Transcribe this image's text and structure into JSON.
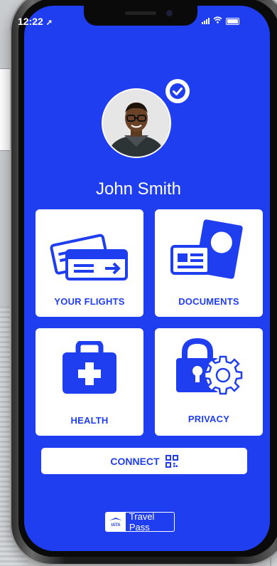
{
  "status_bar": {
    "time": "12:22"
  },
  "profile": {
    "name": "John Smith"
  },
  "tiles": [
    {
      "label": "YOUR FLIGHTS",
      "icon": "flight-tickets-icon"
    },
    {
      "label": "DOCUMENTS",
      "icon": "passport-icon"
    },
    {
      "label": "HEALTH",
      "icon": "medical-kit-icon"
    },
    {
      "label": "PRIVACY",
      "icon": "lock-gear-icon"
    }
  ],
  "connect": {
    "label": "CONNECT",
    "icon": "qr-code-icon"
  },
  "brand": {
    "logo_text": "IATA",
    "label": "Travel Pass"
  },
  "colors": {
    "primary": "#1f3ef0",
    "tile_bg": "#ffffff"
  }
}
